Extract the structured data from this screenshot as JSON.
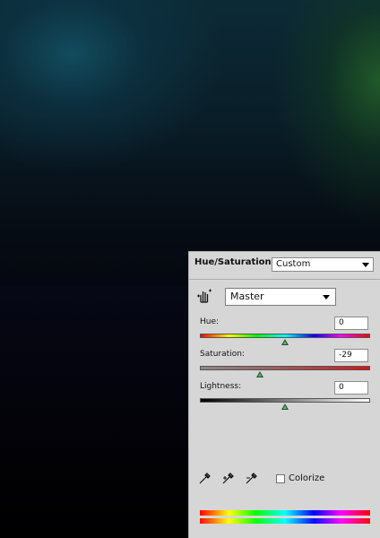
{
  "panel": {
    "title": "Hue/Saturation",
    "preset": "Custom",
    "channel": "Master",
    "hue": {
      "label": "Hue:",
      "value": "0",
      "thumb_fraction": 0.5
    },
    "saturation": {
      "label": "Saturation:",
      "value": "-29",
      "thumb_fraction": 0.355
    },
    "lightness": {
      "label": "Lightness:",
      "value": "0",
      "thumb_fraction": 0.5
    },
    "colorize_label": "Colorize",
    "colorize_checked": false
  },
  "colors": {
    "panel_bg": "#d6d6d6",
    "thumb": "#1c5a2a"
  },
  "icons": [
    "hand-target-adjust-icon",
    "eyedropper-icon",
    "eyedropper-plus-icon",
    "eyedropper-minus-icon",
    "dropdown-arrow-icon"
  ]
}
